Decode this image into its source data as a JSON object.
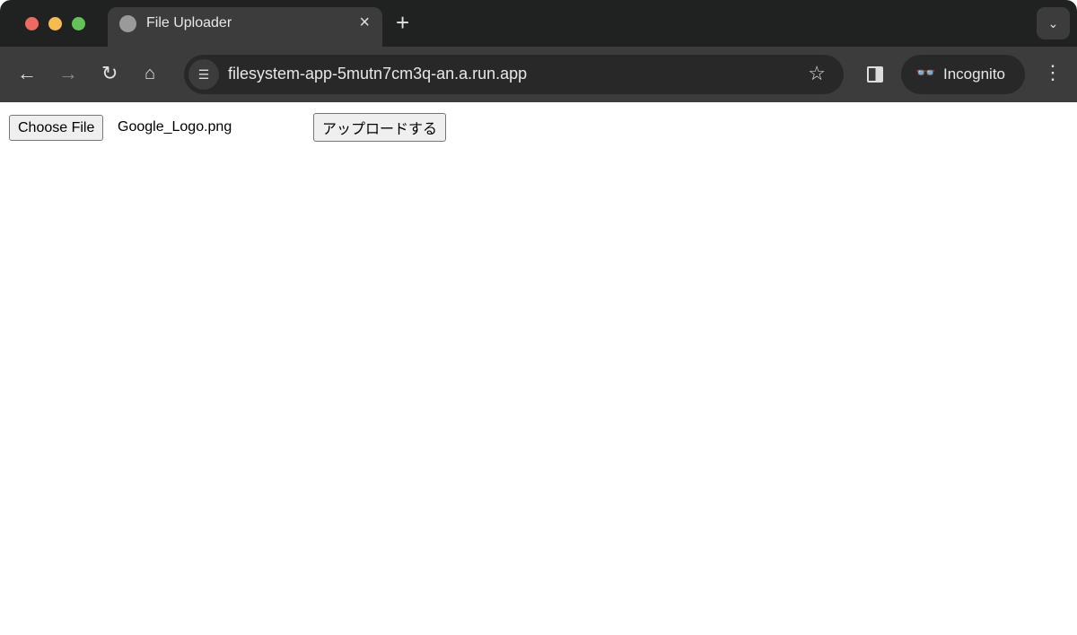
{
  "browser": {
    "tab_title": "File Uploader",
    "tab_close": "×",
    "new_tab": "+",
    "tab_menu": "⌄",
    "url": "filesystem-app-5mutn7cm3q-an.a.run.app",
    "profile_label": "Incognito",
    "icons": [
      "back-icon",
      "forward-icon",
      "reload-icon",
      "home-icon",
      "site-settings-icon",
      "star-icon",
      "side-panel-icon",
      "incognito-icon",
      "menu-icon"
    ],
    "colors": {
      "titlebar": "#202221",
      "toolbar": "#3c3c3c",
      "omnibox": "#282828"
    }
  },
  "page": {
    "choose_file_label": "Choose File",
    "selected_file": "Google_Logo.png",
    "upload_label": "アップロードする"
  }
}
